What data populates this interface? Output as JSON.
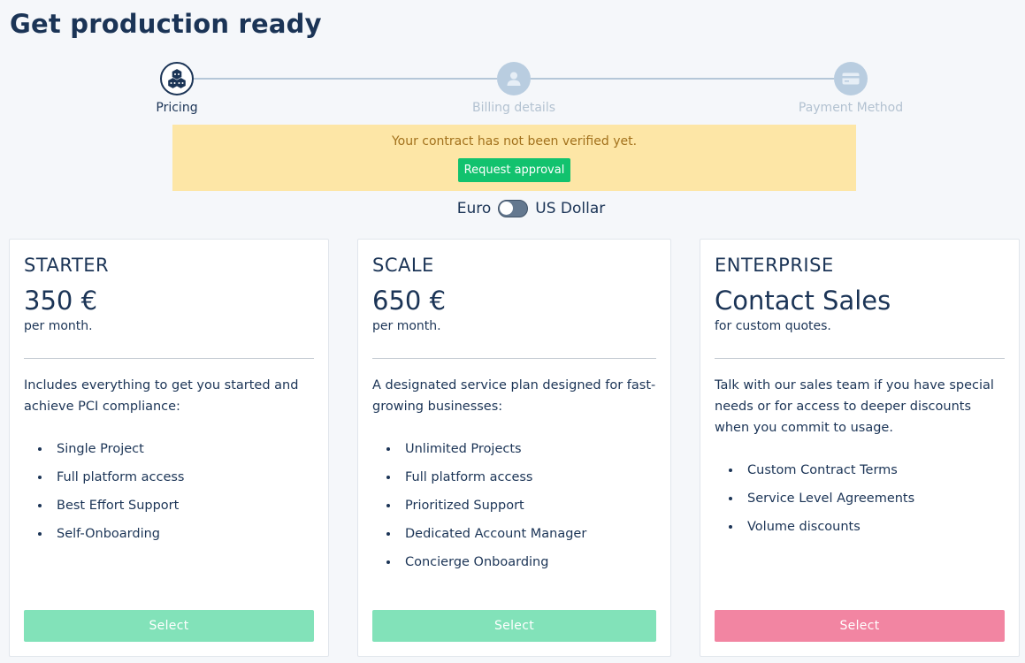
{
  "page": {
    "title": "Get production ready"
  },
  "stepper": {
    "steps": [
      {
        "label": "Pricing",
        "icon": "cubes-icon",
        "state": "active"
      },
      {
        "label": "Billing details",
        "icon": "user-icon",
        "state": "inactive"
      },
      {
        "label": "Payment Method",
        "icon": "credit-card-icon",
        "state": "inactive"
      }
    ]
  },
  "banner": {
    "message": "Your contract has not been verified yet.",
    "button_label": "Request approval",
    "background": "#fde6a6",
    "button_color": "#12c26e"
  },
  "currency": {
    "left_label": "Euro",
    "right_label": "US Dollar",
    "selected": "Euro"
  },
  "plans": [
    {
      "name": "STARTER",
      "price": "350 €",
      "period": "per month.",
      "description": "Includes everything to get you started and achieve PCI compliance:",
      "features": [
        "Single Project",
        "Full platform access",
        "Best Effort Support",
        "Self-Onboarding"
      ],
      "button_label": "Select",
      "button_color": "#82e2b9"
    },
    {
      "name": "SCALE",
      "price": "650 €",
      "period": "per month.",
      "description": "A designated service plan designed for fast-growing businesses:",
      "features": [
        "Unlimited Projects",
        "Full platform access",
        "Prioritized Support",
        "Dedicated Account Manager",
        "Concierge Onboarding"
      ],
      "button_label": "Select",
      "button_color": "#82e2b9"
    },
    {
      "name": "ENTERPRISE",
      "price": "Contact Sales",
      "period": "for custom quotes.",
      "description": "Talk with our sales team if you have special needs or for access to deeper discounts when you commit to usage.",
      "features": [
        "Custom Contract Terms",
        "Service Level Agreements",
        "Volume discounts"
      ],
      "button_label": "Select",
      "button_color": "#f285a2"
    }
  ]
}
